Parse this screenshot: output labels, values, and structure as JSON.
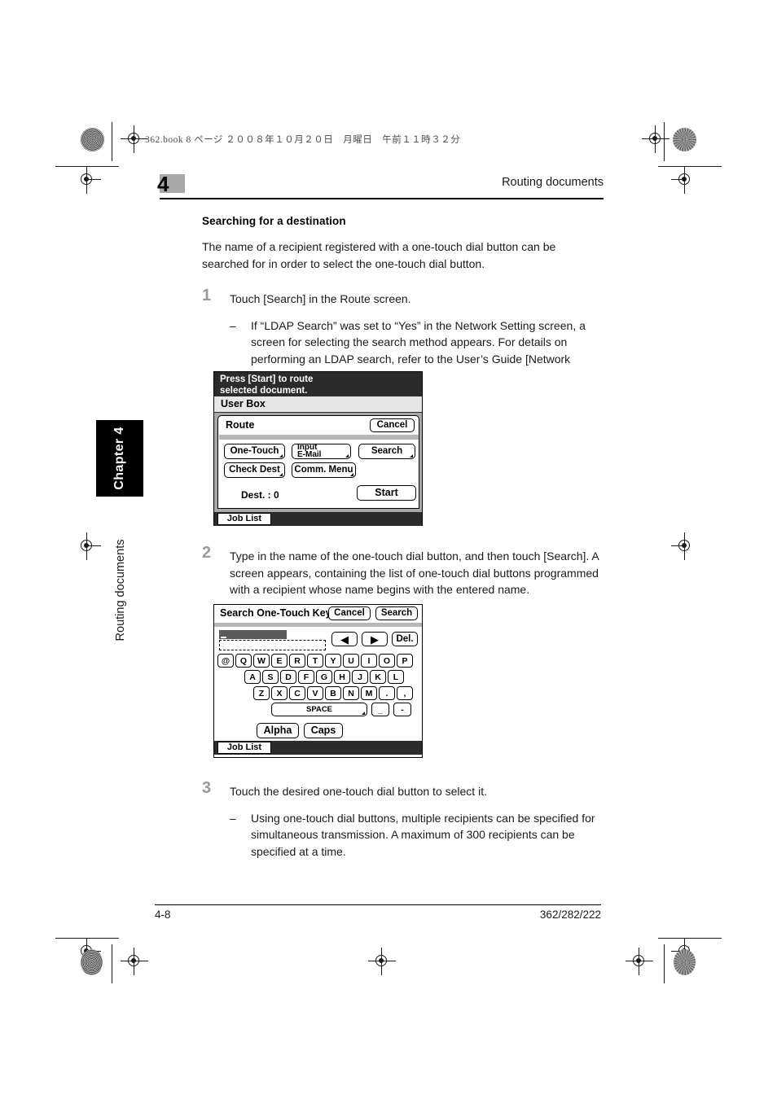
{
  "print_header": {
    "file_line": "362.book  8 ページ  ２００８年１０月２０日　月曜日　午前１１時３２分"
  },
  "header": {
    "chapter_number": "4",
    "title": "Routing documents"
  },
  "side_tab": {
    "label": "Chapter 4",
    "vertical_label": "Routing documents"
  },
  "content": {
    "section_title": "Searching for a destination",
    "intro": "The name of a recipient registered with a one-touch dial button can be searched for in order to select the one-touch dial button.",
    "steps": [
      {
        "number": "1",
        "text": "Touch [Search] in the Route screen.",
        "bullet_dash": "–",
        "bullet_text": "If “LDAP Search” was set to “Yes” in the Network Setting screen, a screen for selecting the search method appears. For details on performing an LDAP search, refer to the User’s Guide [Network Scanner Operations]."
      },
      {
        "number": "2",
        "text": "Type in the name of the one-touch dial button, and then touch [Search]. A screen appears, containing the list of one-touch dial buttons programmed with a recipient whose name begins with the entered name."
      },
      {
        "number": "3",
        "text": "Touch the desired one-touch dial button to select it.",
        "bullet_dash": "–",
        "bullet_text": "Using one-touch dial buttons, multiple recipients can be specified for simultaneous transmission. A maximum of 300 recipients can be specified at a time."
      }
    ]
  },
  "route_screen": {
    "message_line1": "Press [Start] to route",
    "message_line2": "selected document.",
    "user_box_label": "User Box",
    "panel_title": "Route",
    "cancel_label": "Cancel",
    "one_touch_label": "One-Touch",
    "input_email_line1": "Input",
    "input_email_line2": "E-Mail",
    "search_label": "Search",
    "check_dest_label": "Check Dest",
    "comm_menu_label": "Comm. Menu",
    "dest_label": "Dest.  :   0",
    "start_label": "Start",
    "job_list_label": "Job List"
  },
  "keyboard_screen": {
    "title": "Search One-Touch Keys",
    "cancel_label": "Cancel",
    "search_label": "Search",
    "input_value": "",
    "left_arrow": "◀",
    "right_arrow": "▶",
    "del_label": "Del.",
    "row1": [
      "@",
      "Q",
      "W",
      "E",
      "R",
      "T",
      "Y",
      "U",
      "I",
      "O",
      "P"
    ],
    "row2": [
      "A",
      "S",
      "D",
      "F",
      "G",
      "H",
      "J",
      "K",
      "L"
    ],
    "row3": [
      "Z",
      "X",
      "C",
      "V",
      "B",
      "N",
      "M",
      ".",
      ","
    ],
    "space_label": "SPACE",
    "underscore_label": "_",
    "hyphen_label": "-",
    "alpha_label": "Alpha",
    "caps_label": "Caps",
    "job_list_label": "Job List"
  },
  "footer": {
    "page_number": "4-8",
    "model_numbers": "362/282/222"
  },
  "colors": {
    "chapter_swatch": "#a8a8a8",
    "lcd_header": "#2b2b2b",
    "lcd_userbox": "#e6e6e6",
    "lcd_body": "#a9a9a9",
    "step_number": "#9a9a9a"
  }
}
